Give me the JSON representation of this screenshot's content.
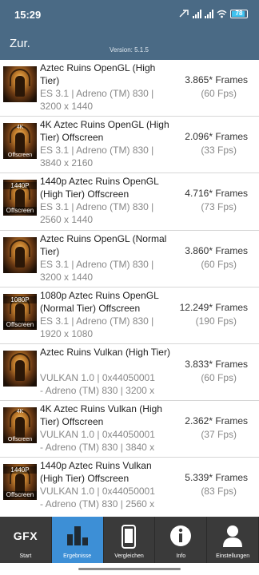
{
  "status": {
    "time": "15:29",
    "battery": "78"
  },
  "header": {
    "back_label": "Zur.",
    "version": "Version: 5.1.5"
  },
  "results": [
    {
      "title": "Aztec Ruins OpenGL (High Tier)",
      "meta": [
        "ES 3.1 | Adreno (TM) 830 |",
        "3200 x 1440"
      ],
      "score": "3.865* Frames",
      "fps": "(60 Fps)",
      "badge_top": "",
      "badge_bottom": "",
      "badge_style": ""
    },
    {
      "title": "4K Aztec Ruins OpenGL (High Tier) Offscreen",
      "meta": [
        "ES 3.1 | Adreno (TM) 830 |",
        "3840 x 2160"
      ],
      "score": "2.096* Frames",
      "fps": "(33 Fps)",
      "badge_top": "4K",
      "badge_bottom": "Offscreen",
      "badge_style": "small"
    },
    {
      "title": "1440p Aztec Ruins OpenGL (High Tier) Offscreen",
      "meta": [
        "ES 3.1 | Adreno (TM) 830 |",
        "2560 x 1440"
      ],
      "score": "4.716* Frames",
      "fps": "(73 Fps)",
      "badge_top": "1440P",
      "badge_bottom": "Offscreen",
      "badge_style": "big"
    },
    {
      "title": "Aztec Ruins OpenGL (Normal Tier)",
      "meta": [
        "ES 3.1 | Adreno (TM) 830 |",
        "3200 x 1440"
      ],
      "score": "3.860* Frames",
      "fps": "(60 Fps)",
      "badge_top": "",
      "badge_bottom": "",
      "badge_style": ""
    },
    {
      "title": "1080p Aztec Ruins OpenGL (Normal Tier) Offscreen",
      "meta": [
        "ES 3.1 | Adreno (TM) 830 |",
        "1920 x 1080"
      ],
      "score": "12.249* Frames",
      "fps": "(190 Fps)",
      "badge_top": "1080P",
      "badge_bottom": "Offscreen",
      "badge_style": "big"
    },
    {
      "title": "Aztec Ruins Vulkan (High Tier)",
      "meta": [
        "VULKAN 1.0 | 0x44050001",
        "- Adreno (TM) 830 | 3200 x"
      ],
      "score": "3.833* Frames",
      "fps": "(60 Fps)",
      "badge_top": "",
      "badge_bottom": "",
      "badge_style": ""
    },
    {
      "title": "4K Aztec Ruins Vulkan (High Tier) Offscreen",
      "meta": [
        "VULKAN 1.0 | 0x44050001",
        "- Adreno (TM) 830 | 3840 x"
      ],
      "score": "2.362* Frames",
      "fps": "(37 Fps)",
      "badge_top": "4K",
      "badge_bottom": "Offscreen",
      "badge_style": "small"
    },
    {
      "title": "1440p Aztec Ruins Vulkan (High Tier) Offscreen",
      "meta": [
        "VULKAN 1.0 | 0x44050001",
        "- Adreno (TM) 830 | 2560 x"
      ],
      "score": "5.339* Frames",
      "fps": "(83 Fps)",
      "badge_top": "1440P",
      "badge_bottom": "Offscreen",
      "badge_style": "big"
    }
  ],
  "tabs": [
    {
      "label": "Start",
      "icon": "gfx-logo-icon",
      "text": "GFX",
      "active": false
    },
    {
      "label": "Ergebnisse",
      "icon": "bar-chart-icon",
      "text": "",
      "active": true
    },
    {
      "label": "Vergleichen",
      "icon": "phone-icon",
      "text": "",
      "active": false
    },
    {
      "label": "Info",
      "icon": "info-icon",
      "text": "",
      "active": false
    },
    {
      "label": "Einstellungen",
      "icon": "user-icon",
      "text": "",
      "active": false
    }
  ],
  "colors": {
    "header": "#4a6a85",
    "tabbar": "#3a3a3a",
    "active_tab": "#3d8fd6"
  }
}
